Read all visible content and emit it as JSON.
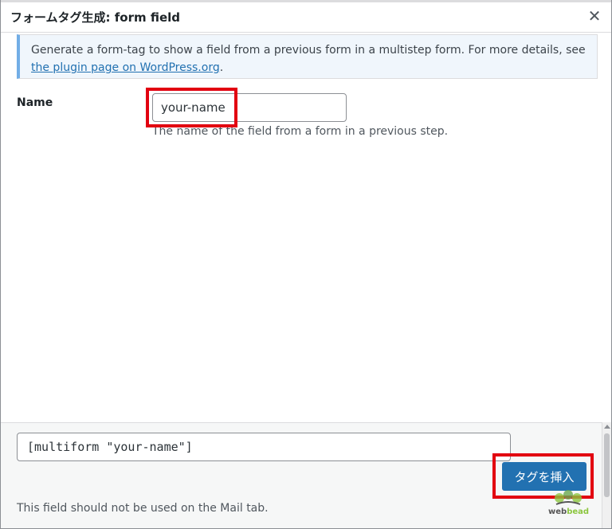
{
  "dialog": {
    "title": "フォームタグ生成: form field",
    "close_symbol": "✕"
  },
  "notice": {
    "text": "Generate a form-tag to show a field from a previous form in a multistep form. For more details, see ",
    "link_text": "the plugin page on WordPress.org",
    "text_end": "."
  },
  "name_field": {
    "label": "Name",
    "value": "your-name",
    "description": "The name of the field from a form in a previous step."
  },
  "footer": {
    "tag_value": "[multiform \"your-name\"]",
    "insert_label": "タグを挿入",
    "note": "This field should not be used on the Mail tab."
  },
  "watermark": {
    "part1": "web",
    "part2": "bead"
  },
  "colors": {
    "accent": "#2271b1",
    "highlight": "#e20010",
    "notice_border": "#72aee6"
  }
}
